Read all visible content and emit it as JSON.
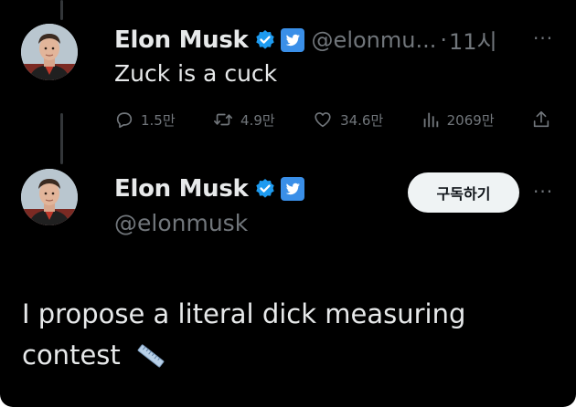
{
  "tweet1": {
    "display_name": "Elon Musk",
    "handle": "@elonmu...",
    "separator": "·",
    "time": "11시",
    "text": "Zuck is a cuck",
    "more": "···",
    "stats": {
      "replies": "1.5만",
      "retweets": "4.9만",
      "likes": "34.6만",
      "views": "2069만"
    }
  },
  "tweet2": {
    "display_name": "Elon Musk",
    "handle": "@elonmusk",
    "subscribe_label": "구독하기",
    "more": "···",
    "text": "I propose a literal dick measuring contest"
  },
  "icons": {
    "verified": "verified-badge-icon",
    "twitter": "twitter-bird-icon",
    "reply": "reply-icon",
    "retweet": "retweet-icon",
    "like": "heart-icon",
    "views": "views-icon",
    "share": "share-icon",
    "ruler": "straight-ruler-emoji"
  },
  "colors": {
    "background": "#000000",
    "text": "#e7e9ea",
    "muted": "#71767b",
    "verified_blue": "#1d9bf0",
    "button_bg": "#eff3f4"
  }
}
